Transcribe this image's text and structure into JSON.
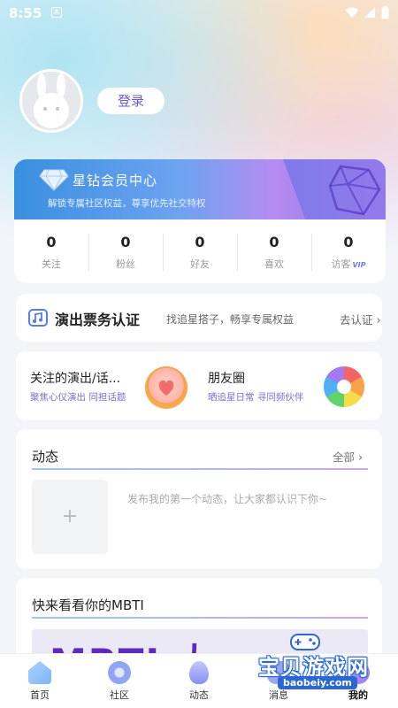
{
  "status_bar": {
    "time": "8:55",
    "notif_glyph": "A"
  },
  "profile": {
    "login_label": "登录"
  },
  "vip": {
    "title": "星钻会员中心",
    "subtitle": "解锁专属社区权益，尊享优先社交特权",
    "stats": [
      {
        "value": "0",
        "label": "关注"
      },
      {
        "value": "0",
        "label": "粉丝"
      },
      {
        "value": "0",
        "label": "好友"
      },
      {
        "value": "0",
        "label": "喜欢"
      },
      {
        "value": "0",
        "label": "访客",
        "tag": "VIP"
      }
    ]
  },
  "ticket": {
    "title": "演出票务认证",
    "subtitle": "找追星搭子，畅享专属权益",
    "action": "去认证"
  },
  "follow": {
    "title": "关注的演出/话...",
    "subtitle": "聚焦心仪演出 同担话题"
  },
  "moments": {
    "title": "朋友圈",
    "subtitle": "晒追星日常 寻同频伙伴"
  },
  "dynamic": {
    "title": "动态",
    "all_label": "全部",
    "add_glyph": "+",
    "hint": "发布我的第一个动态，让大家都认识下你~"
  },
  "mbti": {
    "title": "快来看看你的MBTI",
    "banner_text": "MBTI 大..."
  },
  "tabbar": [
    {
      "label": "首页",
      "icon": "home-icon",
      "color": "#7eb6f5"
    },
    {
      "label": "社区",
      "icon": "star-icon",
      "color": "#8fa6f5"
    },
    {
      "label": "动态",
      "icon": "flame-icon",
      "color": "#8a8ff2"
    },
    {
      "label": "消息",
      "icon": "message-icon",
      "color": "#9aa8f0"
    },
    {
      "label": "我的",
      "icon": "profile-icon",
      "color": "#9b7ef0"
    }
  ],
  "watermark": {
    "text": "宝贝游戏网",
    "url": "baobeiy.com"
  }
}
